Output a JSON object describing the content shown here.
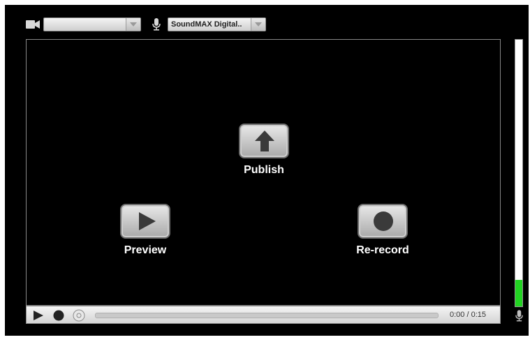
{
  "camera": {
    "icon": "camera-icon",
    "selected": ""
  },
  "microphone": {
    "icon": "microphone-icon",
    "selected": "SoundMAX Digital.."
  },
  "actions": {
    "publish": {
      "label": "Publish",
      "icon": "upload-arrow-icon"
    },
    "preview": {
      "label": "Preview",
      "icon": "play-icon"
    },
    "rerecord": {
      "label": "Re-record",
      "icon": "record-icon"
    }
  },
  "controls": {
    "play_icon": "play-icon",
    "record_icon": "record-icon",
    "time": "0:00 / 0:15",
    "progress": 0
  },
  "level_meter": {
    "level": 0.1,
    "color": "#21d321",
    "icon": "microphone-icon"
  }
}
